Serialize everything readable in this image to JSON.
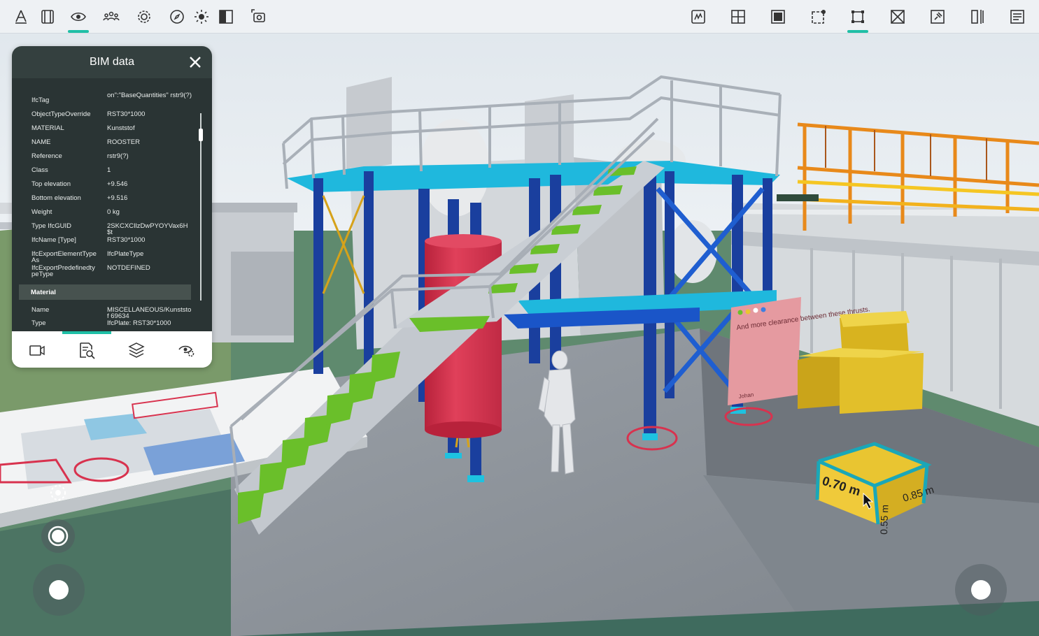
{
  "toolbar": {
    "left_icons": [
      {
        "name": "annotate-icon",
        "active": false
      },
      {
        "name": "section-box-icon",
        "active": false
      },
      {
        "name": "visibility-icon",
        "active": true
      },
      {
        "name": "people-icon",
        "active": false
      },
      {
        "name": "settings-icon",
        "active": false
      },
      {
        "name": "compass-icon",
        "active": false
      },
      {
        "name": "lighting-icon",
        "active": false
      },
      {
        "name": "split-view-icon",
        "active": false
      },
      {
        "name": "focus-camera-icon",
        "active": false
      }
    ],
    "right_icons": [
      {
        "name": "draw-area-icon",
        "active": false
      },
      {
        "name": "add-grid-icon",
        "active": false
      },
      {
        "name": "solid-box-icon",
        "active": false
      },
      {
        "name": "box-dot-icon",
        "active": false
      },
      {
        "name": "measure-box-icon",
        "active": true
      },
      {
        "name": "box-cross-icon",
        "active": false
      },
      {
        "name": "pin-box-icon",
        "active": false
      },
      {
        "name": "align-icon",
        "active": false
      },
      {
        "name": "list-panel-icon",
        "active": false
      }
    ]
  },
  "bim_panel": {
    "title": "BIM data",
    "properties": [
      {
        "key": "IfcTag",
        "value": "on\":\"BaseQuantities\" rstr9(?)"
      },
      {
        "key": "ObjectTypeOverride",
        "value": "RST30*1000"
      },
      {
        "key": "MATERIAL",
        "value": "Kunststof"
      },
      {
        "key": "NAME",
        "value": "ROOSTER"
      },
      {
        "key": "Reference",
        "value": "rstr9(?)"
      },
      {
        "key": "Class",
        "value": "1"
      },
      {
        "key": "Top elevation",
        "value": "+9.546"
      },
      {
        "key": "Bottom elevation",
        "value": "+9.516"
      },
      {
        "key": "Weight",
        "value": "0 kg"
      },
      {
        "key": "Type IfcGUID",
        "value": "2SKCXCIlzDwPYOYVax6H$t"
      },
      {
        "key": "IfcName [Type]",
        "value": "RST30*1000"
      },
      {
        "key": "IfcExportElementType As",
        "value": "IfcPlateType"
      },
      {
        "key": "IfcExportPredefinedty peType",
        "value": "NOTDEFINED"
      }
    ],
    "section_material": "Material",
    "material_rows": [
      {
        "key": "Name",
        "value": "MISCELLANEOUS/Kunststof 69634"
      },
      {
        "key": "Type",
        "value": "IfcPlate: RST30*1000"
      }
    ],
    "tabs": [
      "camera-icon",
      "search-document-icon",
      "layers-icon",
      "visibility-settings-icon"
    ]
  },
  "scene": {
    "note_text": "And more clearance between these thrusts.",
    "note_author": "Johan",
    "dim_width": "0.70 m",
    "dim_depth": "0.85 m",
    "dim_height": "0.55 m",
    "colors": {
      "accent": "#1fbfa6",
      "steel_blue": "#1a3f9e",
      "cyan": "#1ec2e0",
      "grass": "#5f8a6e",
      "floor": "#8a8f96",
      "tank_red": "#d8324e",
      "stair_green": "#6abf2a",
      "box_yellow": "#e9c531"
    }
  }
}
